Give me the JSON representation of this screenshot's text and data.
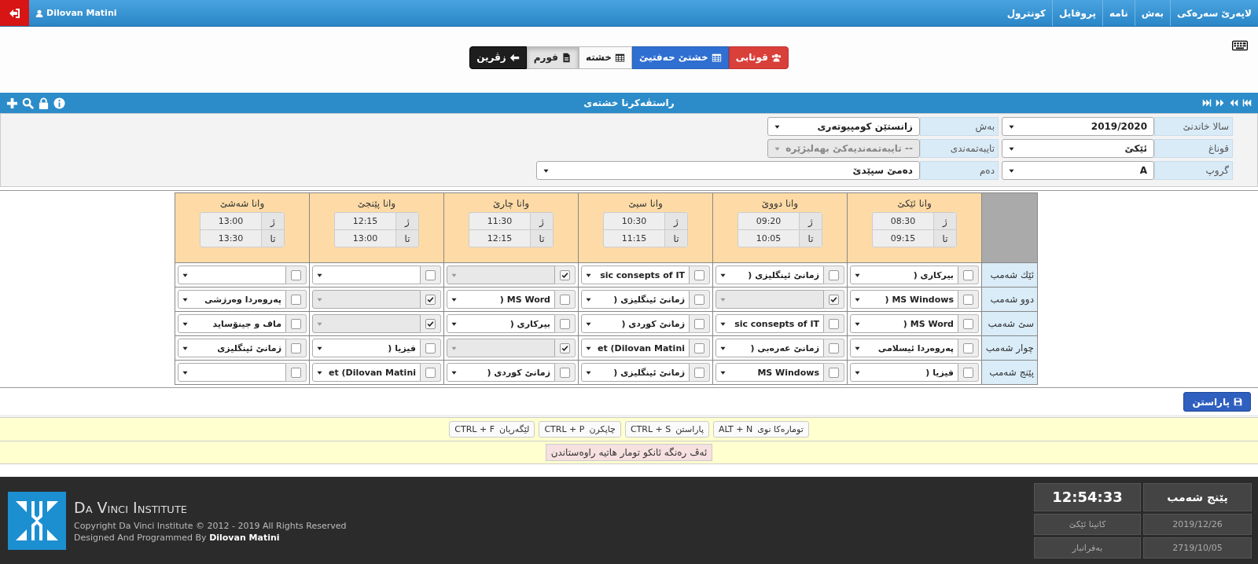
{
  "top_bar": {
    "user": "Dilovan Matini",
    "nav": [
      "لاپەرێ سەرەکی",
      "بەش",
      "نامە",
      "پروفایل",
      "کونترول"
    ]
  },
  "mode_buttons": [
    {
      "label": "قوتابی",
      "kind": "students",
      "selected": false
    },
    {
      "label": "خشتێ حەفتیێ",
      "kind": "weekly",
      "selected": false
    },
    {
      "label": "خشتە",
      "kind": "grid",
      "selected": false
    },
    {
      "label": "فورم",
      "kind": "form",
      "selected": true
    },
    {
      "label": "زڤرین",
      "kind": "back",
      "selected": false
    }
  ],
  "panel": {
    "title": "راستڤەکرنا خشتەی"
  },
  "form": {
    "rows": [
      [
        {
          "label": "سالا خاندنێ",
          "value": "2019/2020",
          "disabled": false
        },
        {
          "label": "بەش",
          "value": "زانستێن کومپیوتەری",
          "disabled": false
        }
      ],
      [
        {
          "label": "قوناغ",
          "value": "ئێکێ",
          "disabled": false
        },
        {
          "label": "تایبەتمەندی",
          "value": "-- تایبەتمەندیەکێ بهەلبژێرە",
          "disabled": true
        }
      ],
      [
        {
          "label": "گروپ",
          "value": "A",
          "disabled": false
        },
        {
          "label": "دەم",
          "value": "دەمێ سپێدێ",
          "disabled": false
        }
      ]
    ]
  },
  "timetable": {
    "lessons": [
      {
        "name": "وانا ئێکێ",
        "start_label": "ژ",
        "start": "08:30",
        "end_label": "تا",
        "end": "09:15"
      },
      {
        "name": "وانا دووێ",
        "start_label": "ژ",
        "start": "09:20",
        "end_label": "تا",
        "end": "10:05"
      },
      {
        "name": "وانا سیێ",
        "start_label": "ژ",
        "start": "10:30",
        "end_label": "تا",
        "end": "11:15"
      },
      {
        "name": "وانا چارێ",
        "start_label": "ژ",
        "start": "11:30",
        "end_label": "تا",
        "end": "12:15"
      },
      {
        "name": "وانا پێنجێ",
        "start_label": "ژ",
        "start": "12:15",
        "end_label": "تا",
        "end": "13:00"
      },
      {
        "name": "وانا شەشێ",
        "start_label": "ژ",
        "start": "13:00",
        "end_label": "تا",
        "end": "13:30"
      }
    ],
    "days": [
      {
        "name": "ئێك شەمب",
        "cells": [
          {
            "checked": false,
            "value": "بیرکاری ("
          },
          {
            "checked": false,
            "value": "زمانێ ئینگلیزی ("
          },
          {
            "checked": false,
            "value": "sic consepts of IT"
          },
          {
            "checked": true
          },
          {
            "checked": false
          },
          {
            "checked": false
          }
        ]
      },
      {
        "name": "دوو شەمب",
        "cells": [
          {
            "checked": false,
            "value": "MS Windows ("
          },
          {
            "checked": true
          },
          {
            "checked": false,
            "value": "زمانێ ئینگلیزی ("
          },
          {
            "checked": false,
            "value": "MS Word ("
          },
          {
            "checked": true
          },
          {
            "checked": false,
            "value": "پەروەردا وەرزشی"
          }
        ]
      },
      {
        "name": "سێ شەمب",
        "cells": [
          {
            "checked": false,
            "value": "MS Word ("
          },
          {
            "checked": false,
            "value": "sic consepts of IT"
          },
          {
            "checked": false,
            "value": "زمانێ کوردی ("
          },
          {
            "checked": false,
            "value": "بیرکاری ("
          },
          {
            "checked": true
          },
          {
            "checked": false,
            "value": "ماف و جینۆساید"
          }
        ]
      },
      {
        "name": "چوار شەمب",
        "cells": [
          {
            "checked": false,
            "value": "پەروەردا ئیسلامی"
          },
          {
            "checked": false,
            "value": "زمانێ عەرەبی ("
          },
          {
            "checked": false,
            "value": "et (Dilovan Matini"
          },
          {
            "checked": true
          },
          {
            "checked": false,
            "value": "فیزیا ("
          },
          {
            "checked": false,
            "value": "زمانێ ئینگلیزی"
          }
        ]
      },
      {
        "name": "پێنج شەمب",
        "cells": [
          {
            "checked": false,
            "value": "فیزیا ("
          },
          {
            "checked": false,
            "value": "MS Windows"
          },
          {
            "checked": false,
            "value": "زمانێ ئینگلیزی ("
          },
          {
            "checked": false,
            "value": "زمانێ کوردی ("
          },
          {
            "checked": false,
            "value": "et (Dilovan Matini"
          },
          {
            "checked": false
          }
        ]
      }
    ]
  },
  "save_button": "پاراستن",
  "shortcuts": [
    {
      "keys": "ALT + N",
      "label": "تومارەکا نوی"
    },
    {
      "keys": "CTRL + S",
      "label": "پاراستن"
    },
    {
      "keys": "CTRL + P",
      "label": "چاپکرن"
    },
    {
      "keys": "CTRL + F",
      "label": "لێگەریان"
    }
  ],
  "notice": "ئەڤ رەنگە ئانکو تومار هاتیە راوەستاندن",
  "footer": {
    "brand": "Da Vinci Institute",
    "copyright": "Copyright Da Vinci Institute © 2012 - 2019 All Rights Reserved",
    "credit": "Designed And Programmed By **Dilovan Matini**",
    "clock": [
      [
        "پێنج شەمب",
        "12:54:33"
      ],
      [
        "2019/12/26",
        "کانینا ئێکێ"
      ],
      [
        "2719/10/05",
        "بەفرانبار"
      ]
    ]
  }
}
